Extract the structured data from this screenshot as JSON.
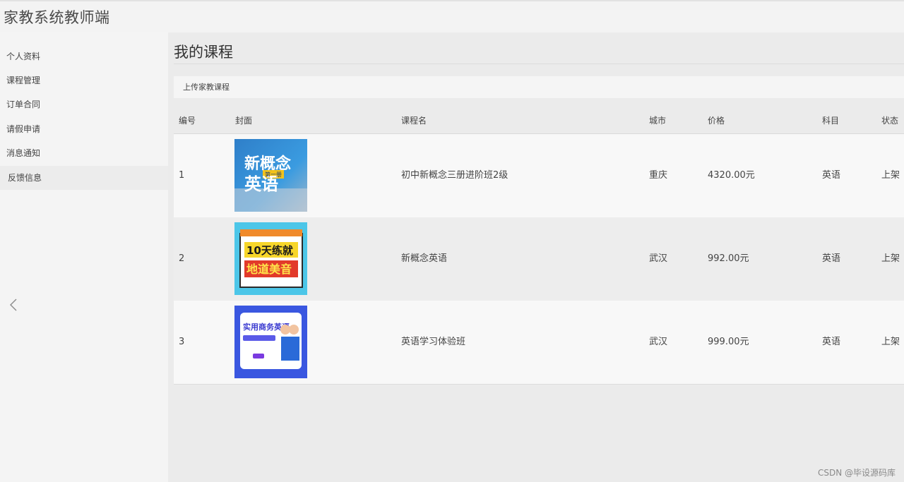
{
  "app": {
    "title": "家教系统教师端"
  },
  "sidebar": {
    "items": [
      {
        "label": "个人资料"
      },
      {
        "label": "课程管理"
      },
      {
        "label": "订单合同"
      },
      {
        "label": "请假申请"
      },
      {
        "label": "消息通知"
      },
      {
        "label": "反馈信息",
        "active": true
      }
    ],
    "collapse_icon": "chevron-left-icon"
  },
  "main": {
    "page_title": "我的课程",
    "upload_label": "上传家教课程",
    "table": {
      "headers": {
        "id": "编号",
        "cover": "封面",
        "name": "课程名",
        "city": "城市",
        "price": "价格",
        "subject": "科目",
        "status": "状态"
      },
      "rows": [
        {
          "id": "1",
          "cover_text": [
            "新概念",
            "英语",
            "第一册"
          ],
          "name": "初中新概念三册进阶班2级",
          "city": "重庆",
          "price": "4320.00元",
          "subject": "英语",
          "status": "上架"
        },
        {
          "id": "2",
          "cover_text": [
            "10天练就",
            "地道美音"
          ],
          "name": "新概念英语",
          "city": "武汉",
          "price": "992.00元",
          "subject": "英语",
          "status": "上架"
        },
        {
          "id": "3",
          "cover_text": [
            "实用商务英语"
          ],
          "name": "英语学习体验班",
          "city": "武汉",
          "price": "999.00元",
          "subject": "英语",
          "status": "上架"
        }
      ]
    }
  },
  "watermark": "CSDN @毕设源码库"
}
